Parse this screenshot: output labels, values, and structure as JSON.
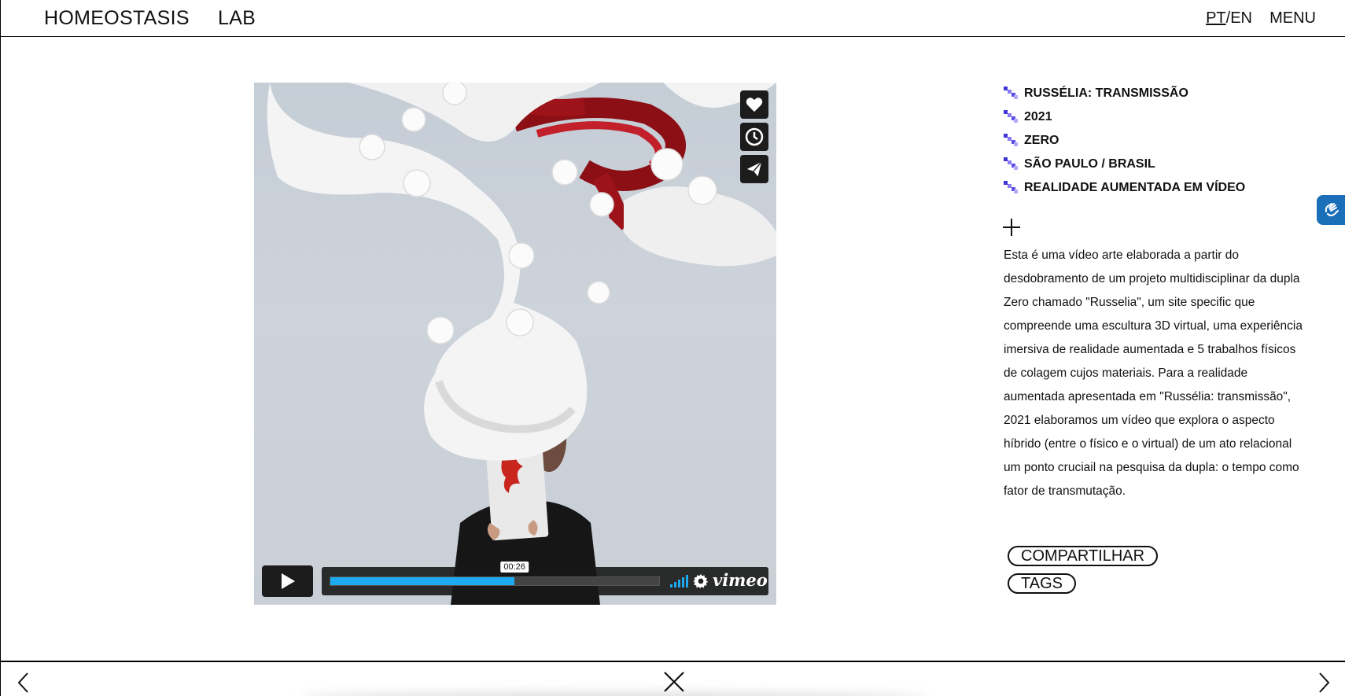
{
  "header": {
    "logo_main": "HOMEOSTASIS",
    "logo_lab": "LAB",
    "lang_pt": "PT",
    "lang_sep": "/",
    "lang_en": "EN",
    "menu_label": "MENU"
  },
  "video": {
    "current_time": "00:26",
    "progress": 0.56,
    "brand": "vimeo",
    "side_actions": [
      "heart-icon",
      "clock-icon",
      "send-icon"
    ],
    "accent_color": "#1eaaf1"
  },
  "info": {
    "items": [
      "RUSSÉLIA: TRANSMISSÃO",
      "2021",
      "ZERO",
      "SÃO PAULO / BRASIL",
      "REALIDADE AUMENTADA EM VÍDEO"
    ],
    "bullet_color": "#6b5cf0",
    "description": "Esta é uma vídeo arte elaborada a partir do desdobramento de um projeto multidisciplinar da dupla Zero chamado \"Russelia\", um site specific que compreende uma escultura 3D virtual, uma experiência imersiva de realidade aumentada e 5 trabalhos físicos de colagem cujos materiais. Para a realidade aumentada apresentada em \"Russélia: transmissão\", 2021 elaboramos um vídeo que explora o aspecto híbrido (entre o físico e o virtual) de um ato relacional um ponto cruciail na pesquisa da dupla: o tempo como fator de transmutação."
  },
  "buttons": {
    "share": "COMPARTILHAR",
    "tags": "TAGS"
  },
  "accessibility": {
    "icon": "sign-language-icon",
    "color": "#1b6fb8"
  },
  "footer": {
    "prev_icon": "chevron-left-icon",
    "close_icon": "close-icon",
    "next_icon": "chevron-right-icon"
  }
}
